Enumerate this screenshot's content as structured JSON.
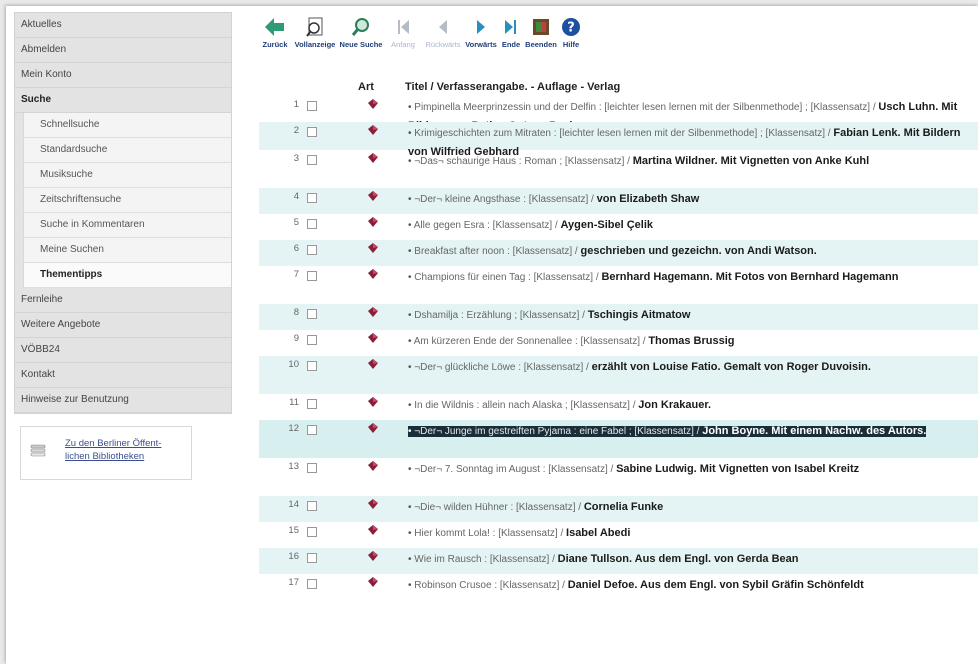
{
  "sidebar": {
    "items": [
      {
        "label": "Aktuelles",
        "type": "top",
        "bold": false
      },
      {
        "label": "Abmelden",
        "type": "top",
        "bold": false
      },
      {
        "label": "Mein Konto",
        "type": "top",
        "bold": false
      },
      {
        "label": "Suche",
        "type": "top",
        "bold": true
      },
      {
        "label": "Schnellsuche",
        "type": "sub",
        "bold": false
      },
      {
        "label": "Standardsuche",
        "type": "sub",
        "bold": false
      },
      {
        "label": "Musiksuche",
        "type": "sub",
        "bold": false
      },
      {
        "label": "Zeitschriftensuche",
        "type": "sub",
        "bold": false
      },
      {
        "label": "Suche in Kommentaren",
        "type": "sub",
        "bold": false
      },
      {
        "label": "Meine Suchen",
        "type": "sub",
        "bold": false
      },
      {
        "label": "Thementipps",
        "type": "sub",
        "bold": true
      },
      {
        "label": "Fernleihe",
        "type": "top",
        "bold": false
      },
      {
        "label": "Weitere Angebote",
        "type": "top",
        "bold": false
      },
      {
        "label": "VÖBB24",
        "type": "top",
        "bold": false
      },
      {
        "label": "Kontakt",
        "type": "top",
        "bold": false
      },
      {
        "label": "Hinweise zur Benutzung",
        "type": "top",
        "bold": false
      }
    ],
    "external_link": "Zu den Berliner Öffent-lichen Bibliotheken"
  },
  "toolbar": [
    {
      "label": "Zurück",
      "icon": "arrow-left-icon",
      "enabled": true
    },
    {
      "label": "Vollanzeige",
      "icon": "magnifier-page-icon",
      "enabled": true
    },
    {
      "label": "Neue Suche",
      "icon": "new-search-icon",
      "enabled": true
    },
    {
      "label": "Anfang",
      "icon": "first-page-icon",
      "enabled": false
    },
    {
      "label": "Rückwärts",
      "icon": "prev-page-icon",
      "enabled": false
    },
    {
      "label": "Vorwärts",
      "icon": "next-page-icon",
      "enabled": true
    },
    {
      "label": "Ende",
      "icon": "last-page-icon",
      "enabled": true
    },
    {
      "label": "Beenden",
      "icon": "exit-icon",
      "enabled": true
    },
    {
      "label": "Hilfe",
      "icon": "help-icon",
      "enabled": true
    }
  ],
  "table": {
    "headers": {
      "art": "Art",
      "title": "Titel / Verfasserangabe. - Auflage - Verlag"
    },
    "rows": [
      {
        "num": "1",
        "pre": "Pimpinella Meerprinzessin und der Delfin : [leichter lesen lernen mit der Silbenmethode] ; [Klassensatz] /",
        "author": "Usch Luhn. Mit Bildern von Betina Gotzen-Beck"
      },
      {
        "num": "2",
        "pre": "Krimigeschichten zum Mitraten : [leichter lesen lernen mit der Silbenmethode] ; [Klassensatz] /",
        "author": "Fabian Lenk. Mit Bildern von Wilfried Gebhard"
      },
      {
        "num": "3",
        "pre": "¬Das¬ schaurige Haus : Roman ; [Klassensatz] /",
        "author": "Martina Wildner. Mit Vignetten von Anke Kuhl"
      },
      {
        "num": "4",
        "pre": "¬Der¬ kleine Angsthase : [Klassensatz] /",
        "author": "von Elizabeth Shaw"
      },
      {
        "num": "5",
        "pre": "Alle gegen Esra : [Klassensatz] /",
        "author": "Aygen-Sibel Çelik"
      },
      {
        "num": "6",
        "pre": "Breakfast after noon : [Klassensatz] /",
        "author": "geschrieben und gezeichn. von Andi Watson."
      },
      {
        "num": "7",
        "pre": "Champions für einen Tag : [Klassensatz] /",
        "author": "Bernhard Hagemann. Mit Fotos von Bernhard Hagemann"
      },
      {
        "num": "8",
        "pre": "Dshamilja : Erzählung ; [Klassensatz] /",
        "author": "Tschingis Aitmatow"
      },
      {
        "num": "9",
        "pre": "Am kürzeren Ende der Sonnenallee : [Klassensatz] /",
        "author": "Thomas Brussig"
      },
      {
        "num": "10",
        "pre": "¬Der¬ glückliche Löwe : [Klassensatz] /",
        "author": "erzählt von Louise Fatio. Gemalt von Roger Duvoisin."
      },
      {
        "num": "11",
        "pre": "In die Wildnis : allein nach Alaska ; [Klassensatz] /",
        "author": "Jon Krakauer."
      },
      {
        "num": "12",
        "pre": "¬Der¬ Junge im gestreiften Pyjama : eine Fabel ; [Klassensatz] /",
        "author": "John Boyne. Mit einem Nachw. des Autors."
      },
      {
        "num": "13",
        "pre": "¬Der¬ 7. Sonntag im August : [Klassensatz] /",
        "author": "Sabine Ludwig. Mit Vignetten von Isabel Kreitz"
      },
      {
        "num": "14",
        "pre": "¬Die¬ wilden Hühner : [Klassensatz] /",
        "author": "Cornelia Funke"
      },
      {
        "num": "15",
        "pre": "Hier kommt Lola! : [Klassensatz] /",
        "author": "Isabel Abedi"
      },
      {
        "num": "16",
        "pre": "Wie im Rausch : [Klassensatz] /",
        "author": "Diane Tullson. Aus dem Engl. von Gerda Bean"
      },
      {
        "num": "17",
        "pre": "Robinson Crusoe : [Klassensatz] /",
        "author": "Daniel Defoe. Aus dem Engl. von Sybil Gräfin Schönfeldt"
      }
    ]
  },
  "colors": {
    "alt_row": "#e4f3f3",
    "highlight": "#1a2e3a",
    "link": "#1f3d7a"
  }
}
